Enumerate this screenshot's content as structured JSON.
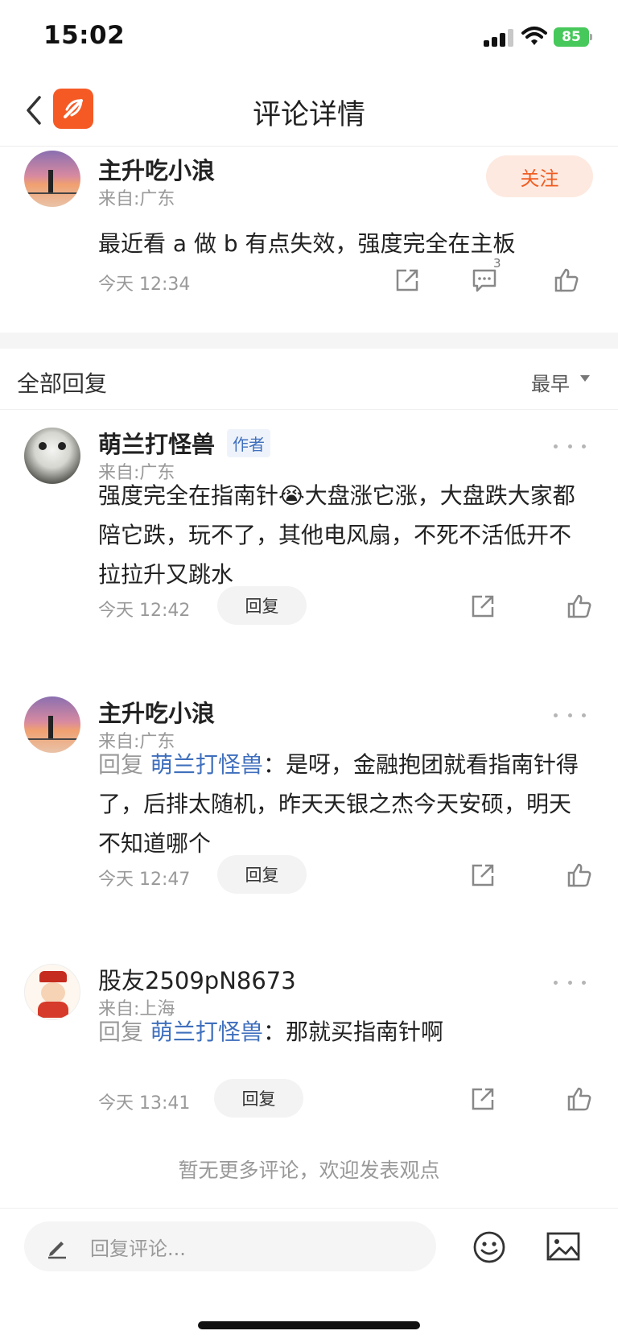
{
  "status_bar": {
    "time": "15:02",
    "battery": "85"
  },
  "header": {
    "title": "评论详情",
    "back_icon": "chevron-left-icon",
    "logo_icon": "app-logo-icon"
  },
  "post": {
    "name": "主升吃小浪",
    "from": "来自:广东",
    "follow_label": "关注",
    "text": "最近看 a 做 b 有点失效，强度完全在主板",
    "time": "今天 12:34",
    "comment_count": "3"
  },
  "replies_header": {
    "title": "全部回复",
    "sort": "最早"
  },
  "comments": [
    {
      "name": "萌兰打怪兽",
      "tag": "作者",
      "from": "来自:广东",
      "text": "强度完全在指南针😭大盘涨它涨，大盘跌大家都陪它跌，玩不了，其他电风扇，不死不活低开不拉拉升又跳水",
      "time": "今天 12:42",
      "reply_label": "回复"
    },
    {
      "name": "主升吃小浪",
      "from": "来自:广东",
      "reply_prefix": "回复",
      "reply_target": "萌兰打怪兽",
      "text": "：是呀，金融抱团就看指南针得了，后排太随机，昨天天银之杰今天安硕，明天不知道哪个",
      "time": "今天 12:47",
      "reply_label": "回复"
    },
    {
      "name": "股友2509pN8673",
      "from": "来自:上海",
      "reply_prefix": "回复",
      "reply_target": "萌兰打怪兽",
      "text": "：那就买指南针啊",
      "time": "今天 13:41",
      "reply_label": "回复"
    }
  ],
  "footer": {
    "no_more": "暂无更多评论，欢迎发表观点"
  },
  "bottom_bar": {
    "placeholder": "回复评论..."
  },
  "colors": {
    "accent": "#f05d22",
    "link": "#3f6fbd",
    "muted": "#999999"
  }
}
